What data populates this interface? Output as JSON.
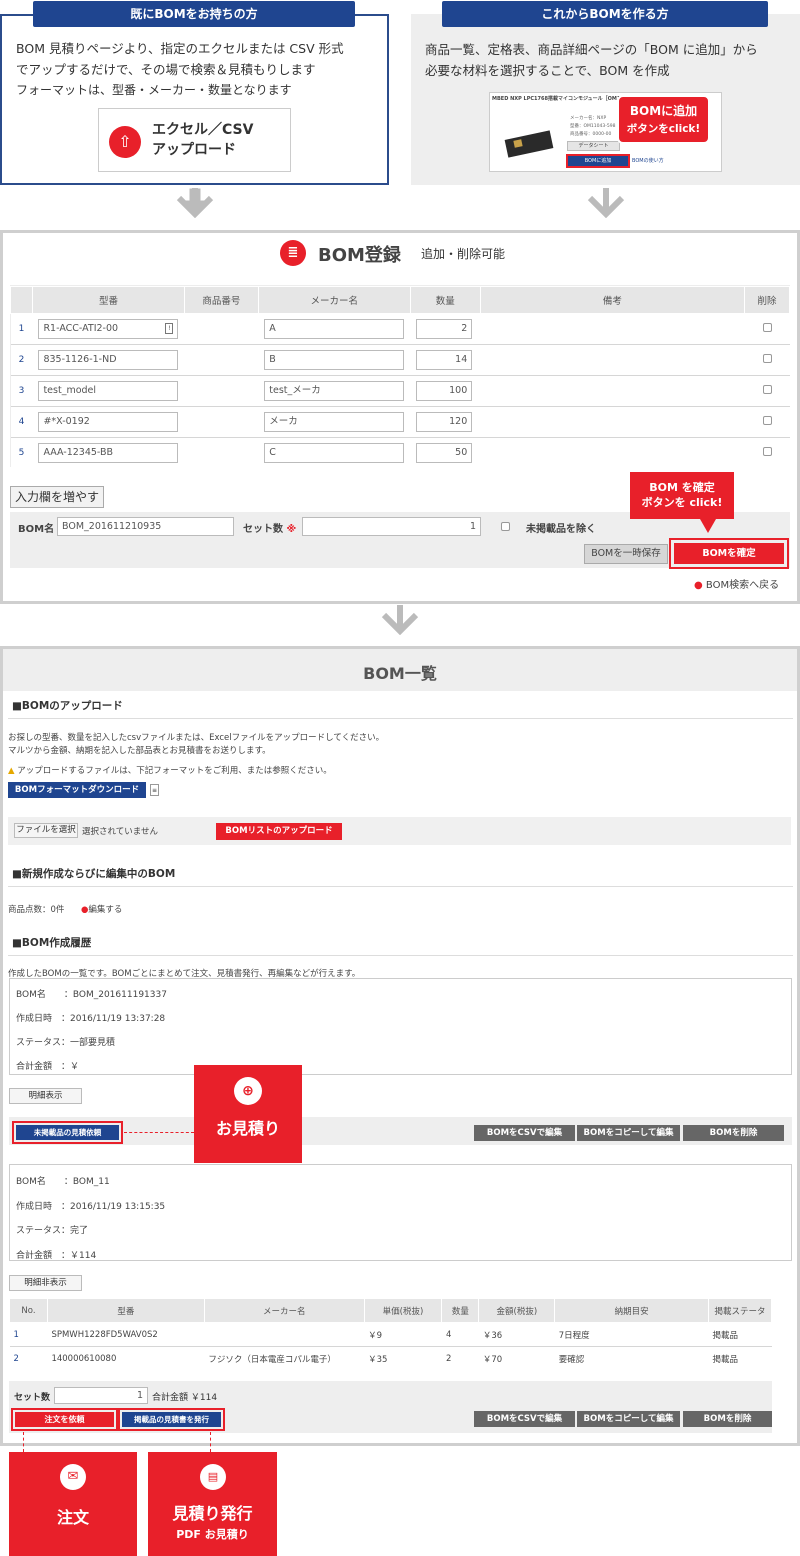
{
  "top_left": {
    "banner": "既にBOMをお持ちの方",
    "line1": "BOM 見積りページより、指定のエクセルまたは CSV 形式",
    "line2": "でアップするだけで、その場で検索＆見積もりします",
    "line3": "フォーマットは、型番・メーカー・数量となります",
    "btn1": "エクセル／CSV",
    "btn2": "アップロード"
  },
  "top_right": {
    "banner": "これからBOMを作る方",
    "line1": "商品一覧、定格表、商品詳細ページの「BOM に追加」から",
    "line2": "必要な材料を選択することで、BOM を作成",
    "shot_title": "MBED NXP LPC1768搭載マイコンモジュール［OM11043-598］",
    "shot_maker": "メーカー名：NXP",
    "shot_part": "型番：OM11043-598",
    "shot_code": "商品番号：0000-00",
    "shot_ds": "データシート",
    "shot_add": "BOMに追加",
    "shot_help": "BOMの使い方",
    "callout1": "BOMに追加",
    "callout2": "ボタンをclick!"
  },
  "register": {
    "title": "BOM登録",
    "subtitle": "追加・削除可能",
    "headers": [
      "型番",
      "商品番号",
      "メーカー名",
      "数量",
      "備考",
      "削除"
    ],
    "rows": [
      {
        "no": "1",
        "part": "R1-ACC-ATI2-00",
        "maker": "A",
        "qty": "2"
      },
      {
        "no": "2",
        "part": "835-1126-1-ND",
        "maker": "B",
        "qty": "14"
      },
      {
        "no": "3",
        "part": "test_model",
        "maker": "test_メーカ",
        "qty": "100"
      },
      {
        "no": "4",
        "part": "#*X-0192",
        "maker": "メーカ",
        "qty": "120"
      },
      {
        "no": "5",
        "part": "AAA-12345-BB",
        "maker": "C",
        "qty": "50"
      }
    ],
    "add_rows": "入力欄を増やす",
    "bom_name_label": "BOM名",
    "bom_name": "BOM_201611210935",
    "set_label": "セット数",
    "required": "※",
    "set_value": "1",
    "exclude": "未掲載品を除く",
    "save_temp": "BOMを一時保存",
    "confirm": "BOMを確定",
    "back": "BOM検索へ戻る",
    "callout1": "BOM を確定",
    "callout2": "ボタンを click!"
  },
  "list": {
    "title": "BOM一覧",
    "upload_heading": "■BOMのアップロード",
    "upload_desc1": "お探しの型番、数量を記入したcsvファイルまたは、Excelファイルをアップロードしてください。",
    "upload_desc2": "マルツから金額、納期を記入した部品表とお見積書をお送りします。",
    "warning": "アップロードするファイルは、下記フォーマットをご利用、または参照ください。",
    "format_dl": "BOMフォーマットダウンロード",
    "file_select": "ファイルを選択",
    "file_none": "選択されていません",
    "upload_btn": "BOMリストのアップロード",
    "new_heading": "■新規作成ならびに編集中のBOM",
    "count": "商品点数：0件",
    "edit": "編集する",
    "history_heading": "■BOM作成履歴",
    "history_desc": "作成したBOMの一覧です。BOMごとにまとめて注文、見積書発行、再編集などが行えます。",
    "bom1": {
      "name": "BOM名　　：BOM_201611191337",
      "date": "作成日時　：2016/11/19 13:37:28",
      "status": "ステータス：一部要見積",
      "total": "合計金額　：￥"
    },
    "show_detail": "明細表示",
    "request_quote": "未掲載品の見積依頼",
    "csv_edit": "BOMをCSVで編集",
    "copy_edit": "BOMをコピーして編集",
    "delete": "BOMを削除",
    "quote_callout": "お見積り",
    "bom2": {
      "name": "BOM名　　：BOM_11",
      "date": "作成日時　：2016/11/19 13:15:35",
      "status": "ステータス：完了",
      "total": "合計金額　：￥114"
    },
    "hide_detail": "明細非表示",
    "detail_headers": [
      "No.",
      "型番",
      "メーカー名",
      "単価(税抜)",
      "数量",
      "金額(税抜)",
      "納期目安",
      "掲載ステータ"
    ],
    "detail_rows": [
      {
        "no": "1",
        "part": "SPMWH1228FD5WAV0S2",
        "maker": "",
        "price": "￥9",
        "qty": "4",
        "amount": "￥36",
        "lead": "7日程度",
        "status": "掲載品"
      },
      {
        "no": "2",
        "part": "140000610080",
        "maker": "フジソク（日本電産コパル電子）",
        "price": "￥35",
        "qty": "2",
        "amount": "￥70",
        "lead": "要確認",
        "status": "掲載品"
      }
    ],
    "set_label": "セット数",
    "set_value": "1",
    "total": "合計金額 ￥114",
    "order": "注文を依頼",
    "issue_quote": "掲載品の見積書を発行"
  },
  "bottom": {
    "order": "注文",
    "quote1": "見積り発行",
    "quote2": "PDF お見積り"
  }
}
